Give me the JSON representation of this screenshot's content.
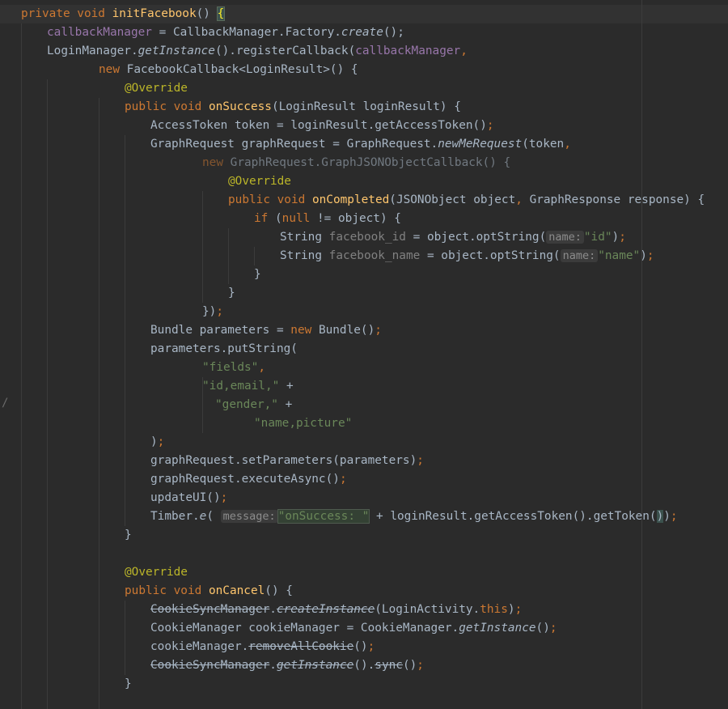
{
  "editor": {
    "lines": [
      [
        [
          "kw",
          "private void "
        ],
        [
          "fn",
          "initFacebook"
        ],
        [
          "p",
          "() "
        ],
        [
          "brace",
          "{"
        ]
      ],
      [
        [
          "fld",
          "callbackManager"
        ],
        [
          "p",
          " = CallbackManager.Factory."
        ],
        [
          "it",
          "create"
        ],
        [
          "p",
          "();"
        ]
      ],
      [
        [
          "p",
          "LoginManager."
        ],
        [
          "it",
          "getInstance"
        ],
        [
          "p",
          "().registerCallback("
        ],
        [
          "fld",
          "callbackManager"
        ],
        [
          "kw",
          ","
        ]
      ],
      [
        [
          "kw",
          "new "
        ],
        [
          "p",
          "FacebookCallback<LoginResult>() {"
        ]
      ],
      [
        [
          "ann",
          "@Override"
        ]
      ],
      [
        [
          "kw",
          "public void "
        ],
        [
          "fn",
          "onSuccess"
        ],
        [
          "p",
          "(LoginResult loginResult) {"
        ]
      ],
      [
        [
          "p",
          "AccessToken token = loginResult.getAccessToken()"
        ],
        [
          "kw",
          ";"
        ]
      ],
      [
        [
          "p",
          "GraphRequest graphRequest = GraphRequest."
        ],
        [
          "it",
          "newMeRequest"
        ],
        [
          "p",
          "(token"
        ],
        [
          "kw",
          ","
        ]
      ],
      [
        [
          "dimkw",
          "new "
        ],
        [
          "dim",
          "GraphRequest.GraphJSONObjectCallback() {"
        ]
      ],
      [
        [
          "ann",
          "@Override"
        ]
      ],
      [
        [
          "kw",
          "public void "
        ],
        [
          "fn",
          "onCompleted"
        ],
        [
          "p",
          "(JSONObject object"
        ],
        [
          "kw",
          ", "
        ],
        [
          "p",
          "GraphResponse response) {"
        ]
      ],
      [
        [
          "kw",
          "if "
        ],
        [
          "p",
          "("
        ],
        [
          "kw",
          "null "
        ],
        [
          "p",
          "!= object) {"
        ]
      ],
      [
        [
          "p",
          "String "
        ],
        [
          "un",
          "facebook_id"
        ],
        [
          "p",
          " = object.optString("
        ],
        [
          "hint",
          "name:"
        ],
        [
          "str",
          "\"id\""
        ],
        [
          "p",
          ")"
        ],
        [
          "kw",
          ";"
        ]
      ],
      [
        [
          "p",
          "String "
        ],
        [
          "un",
          "facebook_name"
        ],
        [
          "p",
          " = object.optString("
        ],
        [
          "hint",
          "name:"
        ],
        [
          "str",
          "\"name\""
        ],
        [
          "p",
          ")"
        ],
        [
          "kw",
          ";"
        ]
      ],
      [
        [
          "p",
          "}"
        ]
      ],
      [
        [
          "p",
          "}"
        ]
      ],
      [
        [
          "p",
          "})"
        ],
        [
          "kw",
          ";"
        ]
      ],
      [
        [
          "p",
          "Bundle parameters = "
        ],
        [
          "kw",
          "new "
        ],
        [
          "p",
          "Bundle()"
        ],
        [
          "kw",
          ";"
        ]
      ],
      [
        [
          "p",
          "parameters.putString("
        ]
      ],
      [
        [
          "str",
          "\"fields\""
        ],
        [
          "kw",
          ","
        ]
      ],
      [
        [
          "str",
          "\"id,email,\""
        ],
        [
          "p",
          " +"
        ]
      ],
      [
        [
          "str",
          "\"gender,\""
        ],
        [
          "p",
          " +"
        ]
      ],
      [
        [
          "str",
          "\"name,picture\""
        ]
      ],
      [
        [
          "p",
          ")"
        ],
        [
          "kw",
          ";"
        ]
      ],
      [
        [
          "p",
          "graphRequest.setParameters(parameters)"
        ],
        [
          "kw",
          ";"
        ]
      ],
      [
        [
          "p",
          "graphRequest.executeAsync()"
        ],
        [
          "kw",
          ";"
        ]
      ],
      [
        [
          "p",
          "updateUI()"
        ],
        [
          "kw",
          ";"
        ]
      ],
      [
        [
          "p",
          "Timber."
        ],
        [
          "it",
          "e"
        ],
        [
          "p",
          "( "
        ],
        [
          "hint",
          "message:"
        ],
        [
          "selstr",
          "\"onSuccess: \""
        ],
        [
          "p",
          " + loginResult.getAccessToken().getToken("
        ],
        [
          "parenhl",
          ")"
        ],
        [
          "p",
          ")"
        ],
        [
          "kw",
          ";"
        ]
      ],
      [
        [
          "p",
          "}"
        ]
      ],
      [],
      [
        [
          "ann",
          "@Override"
        ]
      ],
      [
        [
          "kw",
          "public void "
        ],
        [
          "fn",
          "onCancel"
        ],
        [
          "p",
          "() {"
        ]
      ],
      [
        [
          "strike",
          "CookieSyncManager"
        ],
        [
          "p",
          "."
        ],
        [
          "strikeit",
          "createInstance"
        ],
        [
          "p",
          "(LoginActivity."
        ],
        [
          "kw",
          "this"
        ],
        [
          "p",
          ")"
        ],
        [
          "kw",
          ";"
        ]
      ],
      [
        [
          "p",
          "CookieManager cookieManager = CookieManager."
        ],
        [
          "it",
          "getInstance"
        ],
        [
          "p",
          "()"
        ],
        [
          "kw",
          ";"
        ]
      ],
      [
        [
          "p",
          "cookieManager."
        ],
        [
          "strike",
          "removeAllCookie"
        ],
        [
          "p",
          "()"
        ],
        [
          "kw",
          ";"
        ]
      ],
      [
        [
          "strike",
          "CookieSyncManager"
        ],
        [
          "p",
          "."
        ],
        [
          "strikeit",
          "getInstance"
        ],
        [
          "p",
          "()."
        ],
        [
          "strike",
          "sync"
        ],
        [
          "p",
          "()"
        ],
        [
          "kw",
          ";"
        ]
      ],
      [
        [
          "p",
          "}"
        ]
      ],
      [],
      []
    ]
  }
}
